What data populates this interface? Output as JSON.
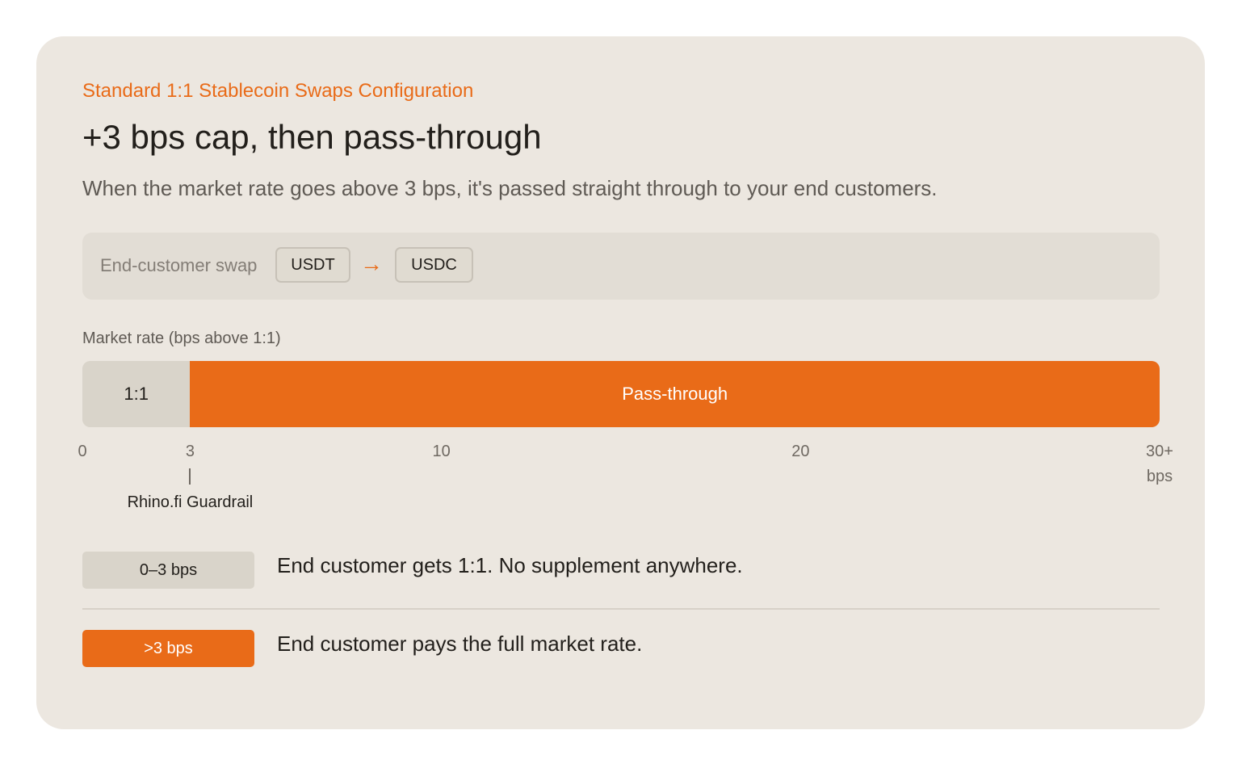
{
  "header": {
    "eyebrow": "Standard 1:1 Stablecoin Swaps Configuration",
    "title": "+3 bps cap, then pass-through",
    "subtitle": "When the market rate goes above 3 bps, it's passed straight through to your end customers."
  },
  "swap": {
    "label": "End-customer swap",
    "from": "USDT",
    "arrow": "→",
    "to": "USDC"
  },
  "chart_data": {
    "type": "bar",
    "axis_label": "Market rate (bps above 1:1)",
    "xlim": [
      0,
      30
    ],
    "segments": [
      {
        "label": "1:1",
        "start": 0,
        "end": 3
      },
      {
        "label": "Pass-through",
        "start": 3,
        "end": 30
      }
    ],
    "ticks": [
      {
        "value": 0,
        "label": "0"
      },
      {
        "value": 3,
        "label": "3"
      },
      {
        "value": 10,
        "label": "10"
      },
      {
        "value": 20,
        "label": "20"
      },
      {
        "value": 30,
        "label": "30+",
        "unit": "bps"
      }
    ],
    "marker": {
      "value": 3,
      "symbol": "|",
      "label": "Rhino.fi Guardrail"
    }
  },
  "legend": [
    {
      "badge": "0–3 bps",
      "text": "End customer gets 1:1. No supplement anywhere."
    },
    {
      "badge": ">3 bps",
      "text": "End customer pays the full market rate."
    }
  ],
  "colors": {
    "accent": "#e96b18",
    "card": "#ece7e0",
    "cap_segment": "#d9d4ca",
    "swap_box": "#e2ddd5"
  }
}
